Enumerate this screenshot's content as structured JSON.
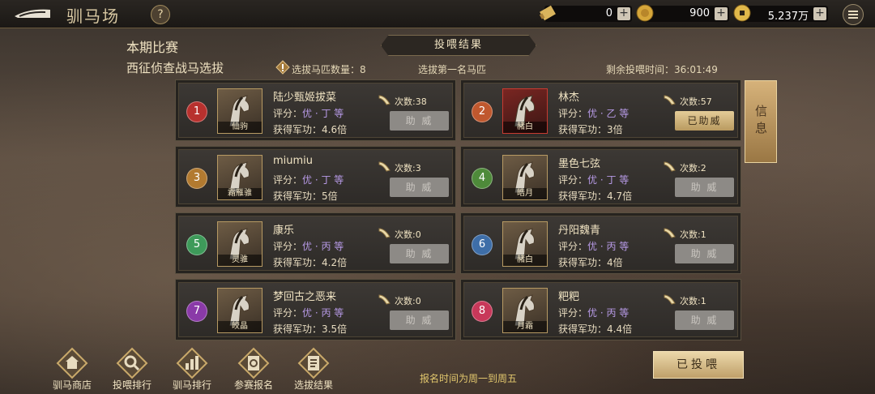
{
  "header": {
    "title": "驯马场",
    "help": "?",
    "resources": [
      {
        "icon": "scroll-icon",
        "value": "0"
      },
      {
        "icon": "gold-coin-icon",
        "value": "900"
      },
      {
        "icon": "copper-coin-icon",
        "value": "5.237万"
      }
    ],
    "plus": "+"
  },
  "season_label": "本期比赛",
  "event_name": "西征侦查战马选拔",
  "result_banner": "投喂结果",
  "selected_count": "选拔马匹数量：8",
  "first_place": "选拔第一名马匹",
  "remaining_time": "剩余投喂时间：36:01:49",
  "info_tab": "信息",
  "entries": [
    {
      "rank": "1",
      "player": "陆少甄姬拔菜",
      "horse": "仙驹",
      "rating_prefix": "评分：",
      "grade": "优 · 丁 等",
      "merit": "获得军功：4.6倍",
      "count": "次数:38",
      "button": "助 威",
      "active": false,
      "color": "#b8312e"
    },
    {
      "rank": "2",
      "player": "林杰",
      "horse": "赭白",
      "rating_prefix": "评分：",
      "grade": "优 · 乙 等",
      "merit": "获得军功：3倍",
      "count": "次数:57",
      "button": "已助威",
      "active": true,
      "color": "#c0582e"
    },
    {
      "rank": "3",
      "player": "miumiu",
      "horse": "霜雁骓",
      "rating_prefix": "评分：",
      "grade": "优 · 丁 等",
      "merit": "获得军功：5倍",
      "count": "次数:3",
      "button": "助 威",
      "active": false,
      "color": "#b27a30"
    },
    {
      "rank": "4",
      "player": "墨色七弦",
      "horse": "皓月",
      "rating_prefix": "评分：",
      "grade": "优 · 丁 等",
      "merit": "获得军功：4.7倍",
      "count": "次数:2",
      "button": "助 威",
      "active": false,
      "color": "#4e8a3a"
    },
    {
      "rank": "5",
      "player": "康乐",
      "horse": "灵骓",
      "rating_prefix": "评分：",
      "grade": "优 · 丙 等",
      "merit": "获得军功：4.2倍",
      "count": "次数:0",
      "button": "助 威",
      "active": false,
      "color": "#3e9a5a"
    },
    {
      "rank": "6",
      "player": "丹阳魏青",
      "horse": "赭白",
      "rating_prefix": "评分：",
      "grade": "优 · 丙 等",
      "merit": "获得军功：4倍",
      "count": "次数:1",
      "button": "助 威",
      "active": false,
      "color": "#3e6ea8"
    },
    {
      "rank": "7",
      "player": "梦回古之恶来",
      "horse": "皎晶",
      "rating_prefix": "评分：",
      "grade": "优 · 丙 等",
      "merit": "获得军功：3.5倍",
      "count": "次数:0",
      "button": "助 威",
      "active": false,
      "color": "#8a3aa8"
    },
    {
      "rank": "8",
      "player": "粑粑",
      "horse": "月霜",
      "rating_prefix": "评分：",
      "grade": "优 · 丙 等",
      "merit": "获得军功：4.4倍",
      "count": "次数:1",
      "button": "助 威",
      "active": false,
      "color": "#c8385a"
    }
  ],
  "nav": [
    {
      "label": "驯马商店",
      "icon": "shop-icon"
    },
    {
      "label": "投喂排行",
      "icon": "search-icon"
    },
    {
      "label": "驯马排行",
      "icon": "bar-chart-icon"
    },
    {
      "label": "参赛报名",
      "icon": "scroll-form-icon"
    },
    {
      "label": "选拔结果",
      "icon": "result-scroll-icon"
    }
  ],
  "signup_note": "报名时间为周一到周五",
  "fed_button": "已投喂"
}
